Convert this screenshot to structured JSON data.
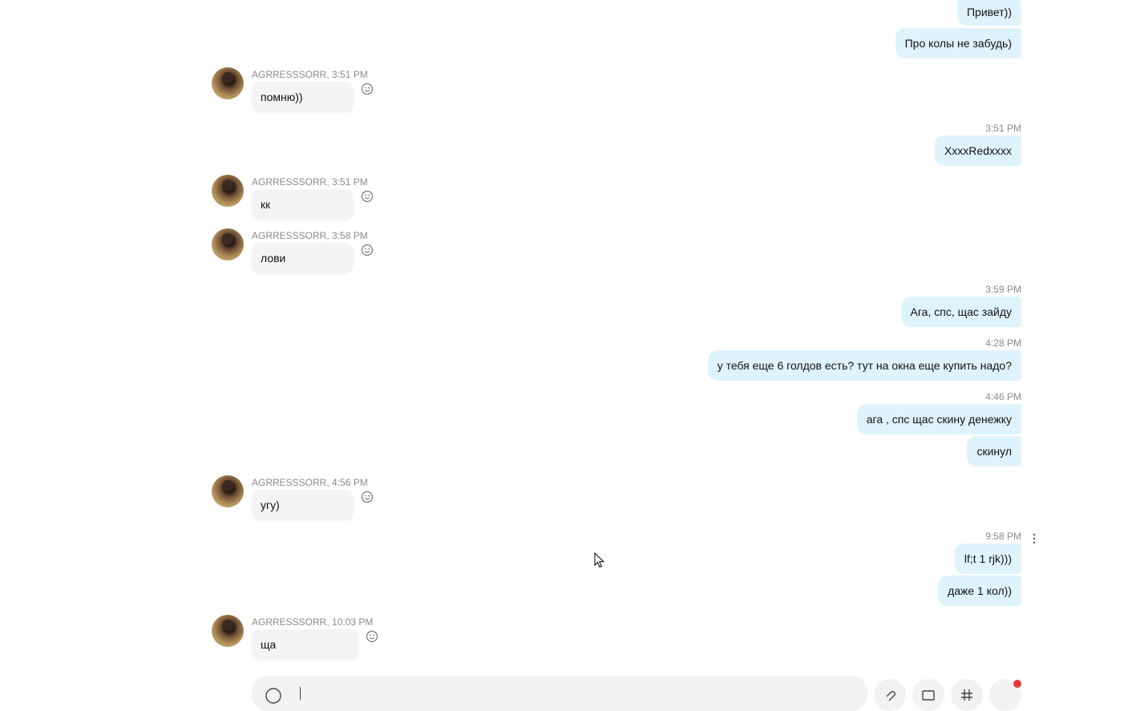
{
  "contact": {
    "name": "AGRRESSSORR"
  },
  "messages": {
    "out1": {
      "text": "Привет))"
    },
    "out2": {
      "text": "Про колы не забудь)"
    },
    "in1": {
      "sender_time": "AGRRESSSORR, 3:51 PM",
      "text": "помню))"
    },
    "out3": {
      "time": "3:51 PM",
      "text": "XxxxRedxxxx"
    },
    "in2": {
      "sender_time": "AGRRESSSORR, 3:51 PM",
      "text": "кк"
    },
    "in3": {
      "sender_time": "AGRRESSSORR, 3:58 PM",
      "text": "лови"
    },
    "out4": {
      "time": "3:59 PM",
      "text": "Ага, спс, щас зайду"
    },
    "out5": {
      "time": "4:28 PM",
      "text": "у тебя еще 6 голдов есть? тут на окна еще купить надо?"
    },
    "out6": {
      "time": "4:46 PM",
      "text": "ага , спс щас скину денежку"
    },
    "out7": {
      "text": "скинул"
    },
    "in4": {
      "sender_time": "AGRRESSSORR, 4:56 PM",
      "text": "угу)"
    },
    "out8": {
      "time": "9:58 PM",
      "text": "lf;t 1 rjk)))"
    },
    "out9": {
      "text": "даже 1 кол))"
    },
    "in5": {
      "sender_time": "AGRRESSSORR, 10:03 PM",
      "text": "ща"
    }
  },
  "icons": {
    "reaction": "smiley-face-icon",
    "more": "vertical-dots-icon",
    "emoji": "emoji-icon",
    "attach": "attach-file-icon",
    "image": "image-icon",
    "contacts": "contact-card-icon",
    "record": "record-button-icon"
  },
  "colors": {
    "outgoing_bubble": "#dff3fd",
    "incoming_bubble": "#f3f4f5",
    "notification_dot": "#e53935"
  }
}
